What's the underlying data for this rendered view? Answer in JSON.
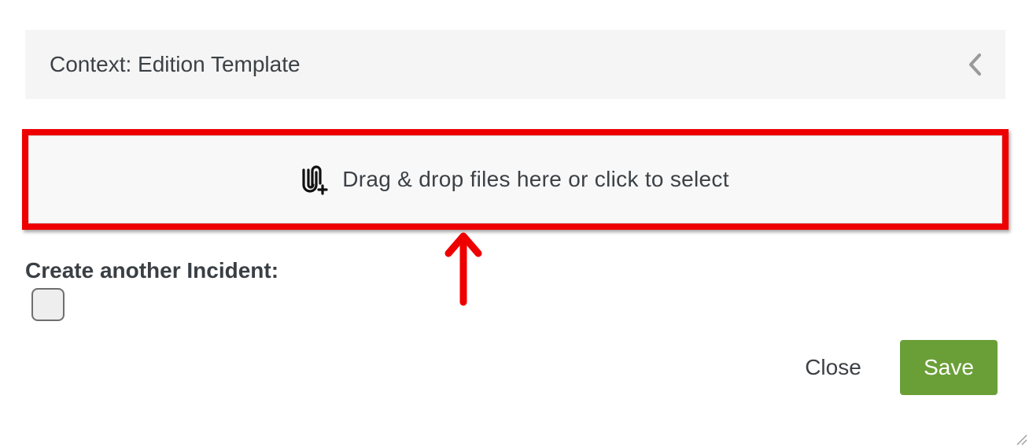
{
  "context_bar": {
    "title": "Context: Edition Template",
    "toggle_icon": "chevron-left-icon"
  },
  "dropzone": {
    "icon": "paperclip-plus-icon",
    "text": "Drag & drop files here or click to select"
  },
  "annotation": {
    "highlight_color": "#ee0000",
    "arrow_icon": "arrow-up-icon"
  },
  "create_another": {
    "label": "Create another Incident:",
    "checked": false
  },
  "footer": {
    "close_label": "Close",
    "save_label": "Save",
    "save_color": "#6a9f37"
  }
}
